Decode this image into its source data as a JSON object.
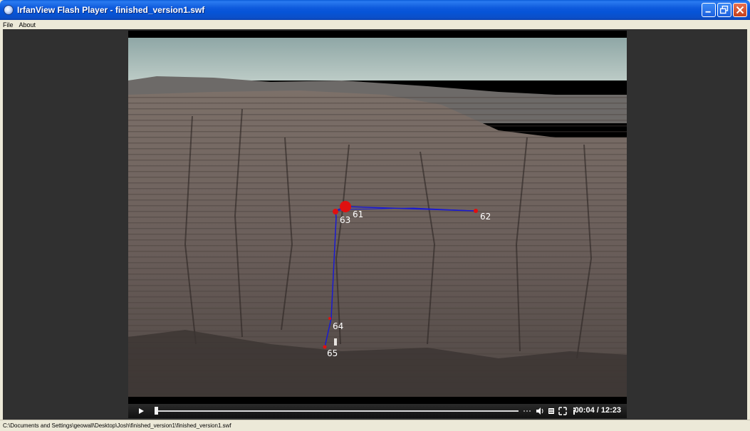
{
  "window": {
    "title": "IrfanView Flash Player - finished_version1.swf"
  },
  "menu": {
    "items": [
      "File",
      "About"
    ]
  },
  "markers": [
    {
      "label": "61"
    },
    {
      "label": "62"
    },
    {
      "label": "63"
    },
    {
      "label": "64"
    },
    {
      "label": "65"
    }
  ],
  "player": {
    "time": "00:04 / 12:23",
    "progress_fraction": 0.01
  },
  "statusbar": {
    "path": "C:\\Documents and Settings\\geowall\\Desktop\\Josh\\finished_version1\\finished_version1.swf"
  },
  "colors": {
    "marker": "#E01010",
    "route_line": "#1A1AD0",
    "sky": "#A9BFBF",
    "cliff": "#6E625E"
  }
}
